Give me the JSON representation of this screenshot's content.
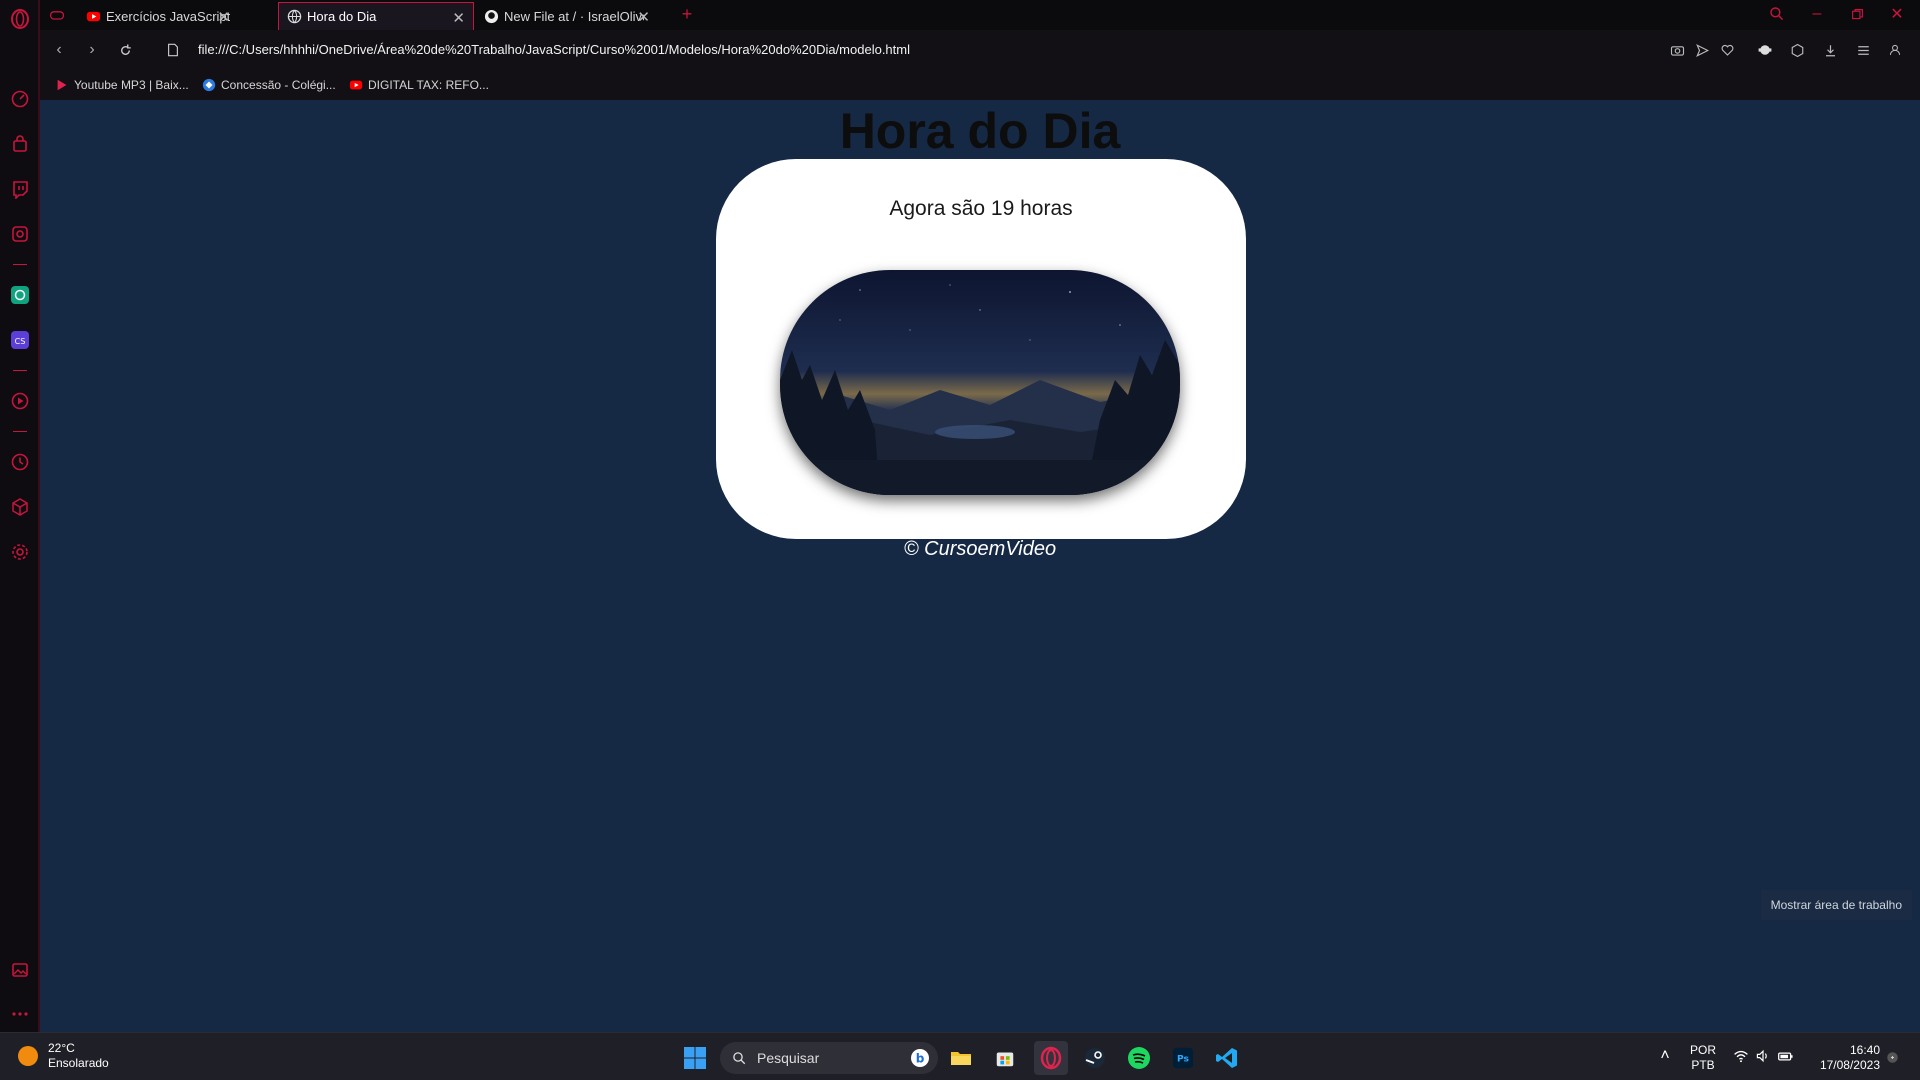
{
  "browser": {
    "tabs": [
      {
        "title": "Exercícios JavaScript (Parte",
        "favicon": "youtube-icon",
        "active": false
      },
      {
        "title": "Hora do Dia",
        "favicon": "globe-icon",
        "active": true
      },
      {
        "title": "New File at / · IsraelOliver/",
        "favicon": "github-icon",
        "active": false
      }
    ],
    "url": "file:///C:/Users/hhhhi/OneDrive/Área%20de%20Trabalho/JavaScript/Curso%2001/Modelos/Hora%20do%20Dia/modelo.html",
    "bookmarks": [
      {
        "label": "Youtube MP3 | Baix...",
        "icon": "youtube-mp3-icon"
      },
      {
        "label": "Concessão - Colégi...",
        "icon": "school-icon"
      },
      {
        "label": "DIGITAL TAX: REFO...",
        "icon": "youtube-icon"
      }
    ]
  },
  "page": {
    "title": "Hora do Dia",
    "message": "Agora são 19 horas",
    "footer": "© CursoemVideo",
    "image": "night-landscape"
  },
  "overlay": {
    "show_desktop": "Mostrar área de trabalho"
  },
  "taskbar": {
    "weather_temp": "22°C",
    "weather_desc": "Ensolarado",
    "search_placeholder": "Pesquisar",
    "lang_top": "POR",
    "lang_bottom": "PTB",
    "time": "16:40",
    "date": "17/08/2023"
  },
  "colors": {
    "accent": "#c8153c",
    "page_bg": "#152844",
    "card_bg": "#ffffff"
  }
}
